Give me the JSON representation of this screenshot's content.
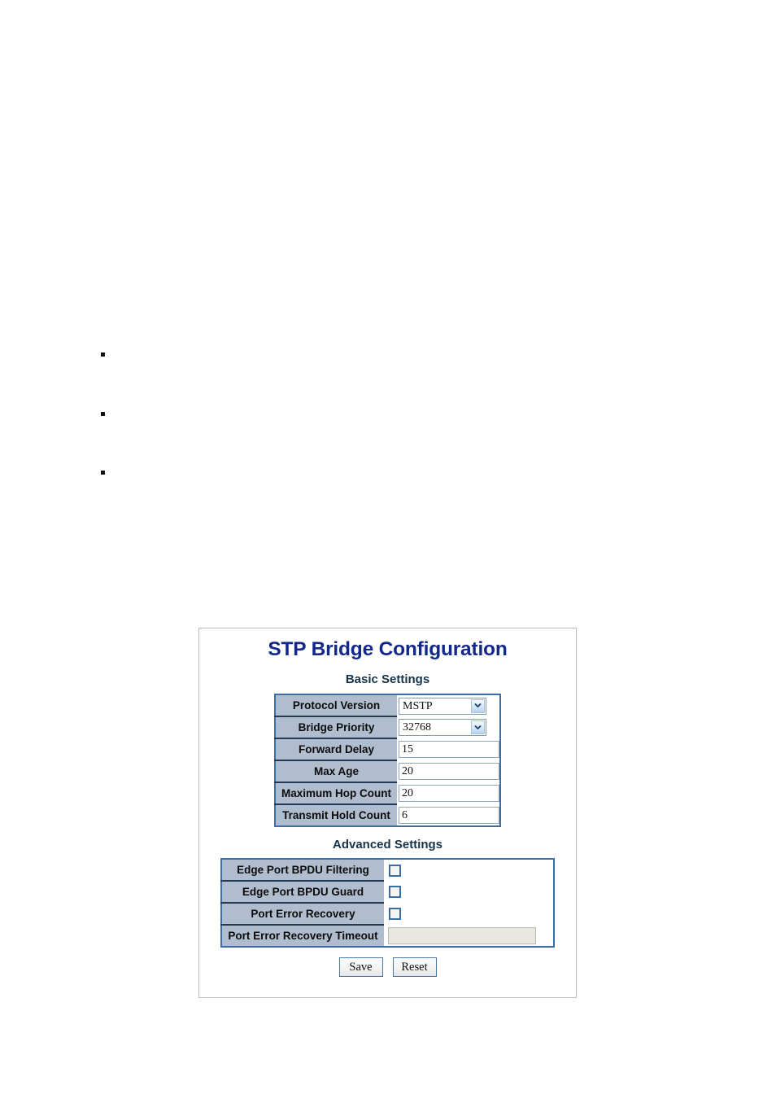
{
  "document": {
    "bullets": [
      "",
      "",
      ""
    ]
  },
  "screenshot": {
    "page_title": "STP Bridge Configuration",
    "basic": {
      "section_title": "Basic Settings",
      "rows": [
        {
          "label": "Protocol Version",
          "type": "select",
          "value": "MSTP"
        },
        {
          "label": "Bridge Priority",
          "type": "select",
          "value": "32768"
        },
        {
          "label": "Forward Delay",
          "type": "text",
          "value": "15"
        },
        {
          "label": "Max Age",
          "type": "text",
          "value": "20"
        },
        {
          "label": "Maximum Hop Count",
          "type": "text",
          "value": "20"
        },
        {
          "label": "Transmit Hold Count",
          "type": "text",
          "value": "6"
        }
      ]
    },
    "advanced": {
      "section_title": "Advanced Settings",
      "rows": [
        {
          "label": "Edge Port BPDU Filtering",
          "type": "checkbox",
          "checked": false
        },
        {
          "label": "Edge Port BPDU Guard",
          "type": "checkbox",
          "checked": false
        },
        {
          "label": "Port Error Recovery",
          "type": "checkbox",
          "checked": false
        },
        {
          "label": "Port Error Recovery Timeout",
          "type": "text-disabled",
          "value": ""
        }
      ]
    },
    "buttons": {
      "save_label": "Save",
      "reset_label": "Reset"
    },
    "colors": {
      "title_blue": "#14288c",
      "section_navy": "#16334a",
      "label_cell": "#b0bdce",
      "table_border": "#3c6ea5",
      "disabled_field": "#e9e8e0"
    },
    "icons": {
      "dropdown": "chevron-down-icon"
    }
  }
}
